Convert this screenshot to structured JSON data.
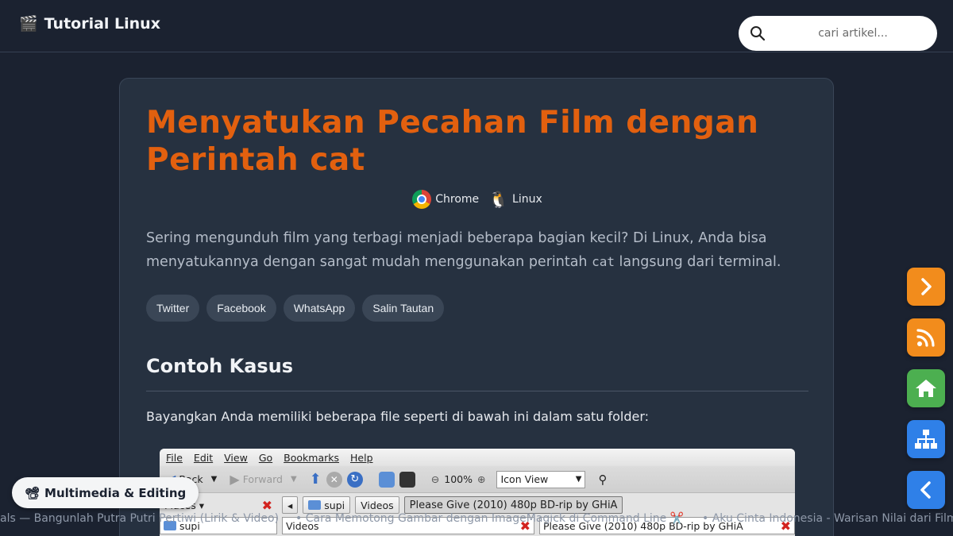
{
  "header": {
    "brand_icon": "🎬",
    "brand_title": "Tutorial Linux",
    "search_placeholder": "cari artikel..."
  },
  "article": {
    "title": "Menyatukan Pecahan Film dengan Perintah cat",
    "platforms": [
      "Chrome",
      "Linux"
    ],
    "intro_part1": "Sering mengunduh film yang terbagi menjadi beberapa bagian kecil? Di Linux, Anda bisa menyatukannya dengan sangat mudah menggunakan perintah ",
    "intro_code": "cat",
    "intro_part2": " langsung dari terminal.",
    "share_buttons": [
      "Twitter",
      "Facebook",
      "WhatsApp",
      "Salin Tautan"
    ],
    "section_heading": "Contoh Kasus",
    "section_paragraph": "Bayangkan Anda memiliki beberapa file seperti di bawah ini dalam satu folder:"
  },
  "file_manager": {
    "menu": [
      "File",
      "Edit",
      "View",
      "Go",
      "Bookmarks",
      "Help"
    ],
    "back_label": "Back",
    "forward_label": "Forward",
    "zoom_label": "100%",
    "view_mode": "Icon View",
    "places_label": "Places",
    "path_folder": "supi",
    "path_videos": "Videos",
    "path_current": "Please Give (2010) 480p BD-rip by GHiA",
    "pane_folder": "supi",
    "pane_videos": "Videos",
    "pane_current": "Please Give (2010) 480p BD-rip by GHiA"
  },
  "ticker": {
    "item1": "als — Bangunlah Putra Putri Pertiwi (Lirik & Video)",
    "item2": "• Cara Memotong Gambar dengan ImageMagick di Command Line ✂️",
    "item3": "• Aku Cinta Indonesia - Warisan Nilai dari Film"
  },
  "category": {
    "icon": "📽",
    "label": "Multimedia & Editing"
  },
  "colors": {
    "accent_title": "#e2600f",
    "fab_orange": "#f28c1c",
    "fab_green": "#4caf50",
    "fab_blue": "#2f80e8"
  },
  "fab_icons": [
    "chevron-right-icon",
    "rss-icon",
    "home-icon",
    "sitemap-icon",
    "chevron-left-icon"
  ]
}
